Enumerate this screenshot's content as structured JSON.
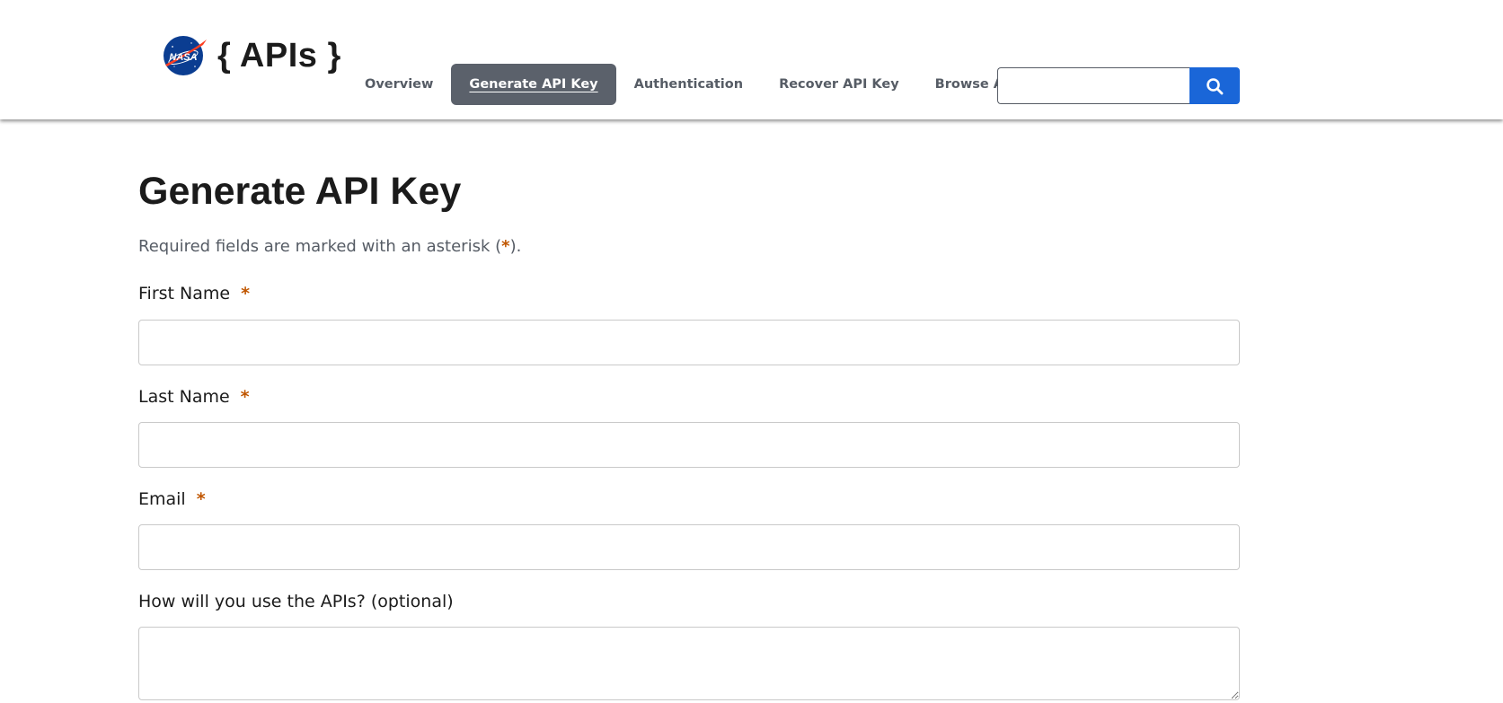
{
  "header": {
    "brand": {
      "logo_icon": "nasa-meatball-logo",
      "logo_text": "NASA",
      "title": "{ APIs }"
    },
    "nav": {
      "items": [
        {
          "label": "Overview",
          "active": false
        },
        {
          "label": "Generate API Key",
          "active": true
        },
        {
          "label": "Authentication",
          "active": false
        },
        {
          "label": "Recover API Key",
          "active": false
        },
        {
          "label": "Browse APIs",
          "active": false
        }
      ]
    },
    "search": {
      "value": "",
      "button_icon": "search-icon"
    }
  },
  "main": {
    "title": "Generate API Key",
    "required_note": {
      "prefix": "Required fields are marked with an asterisk (",
      "asterisk": "*",
      "suffix": ")."
    },
    "fields": [
      {
        "label": "First Name",
        "required_marker": "*",
        "value": ""
      },
      {
        "label": "Last Name",
        "required_marker": "*",
        "value": ""
      },
      {
        "label": "Email",
        "required_marker": "*",
        "value": ""
      },
      {
        "label": "How will you use the APIs? (optional)",
        "value": ""
      }
    ]
  },
  "colors": {
    "nav_active_bg": "#5b616b",
    "search_button_bg": "#1a66d8",
    "required_asterisk": "#c05600",
    "text_primary": "#1b1b1b",
    "text_secondary": "#565c65"
  }
}
